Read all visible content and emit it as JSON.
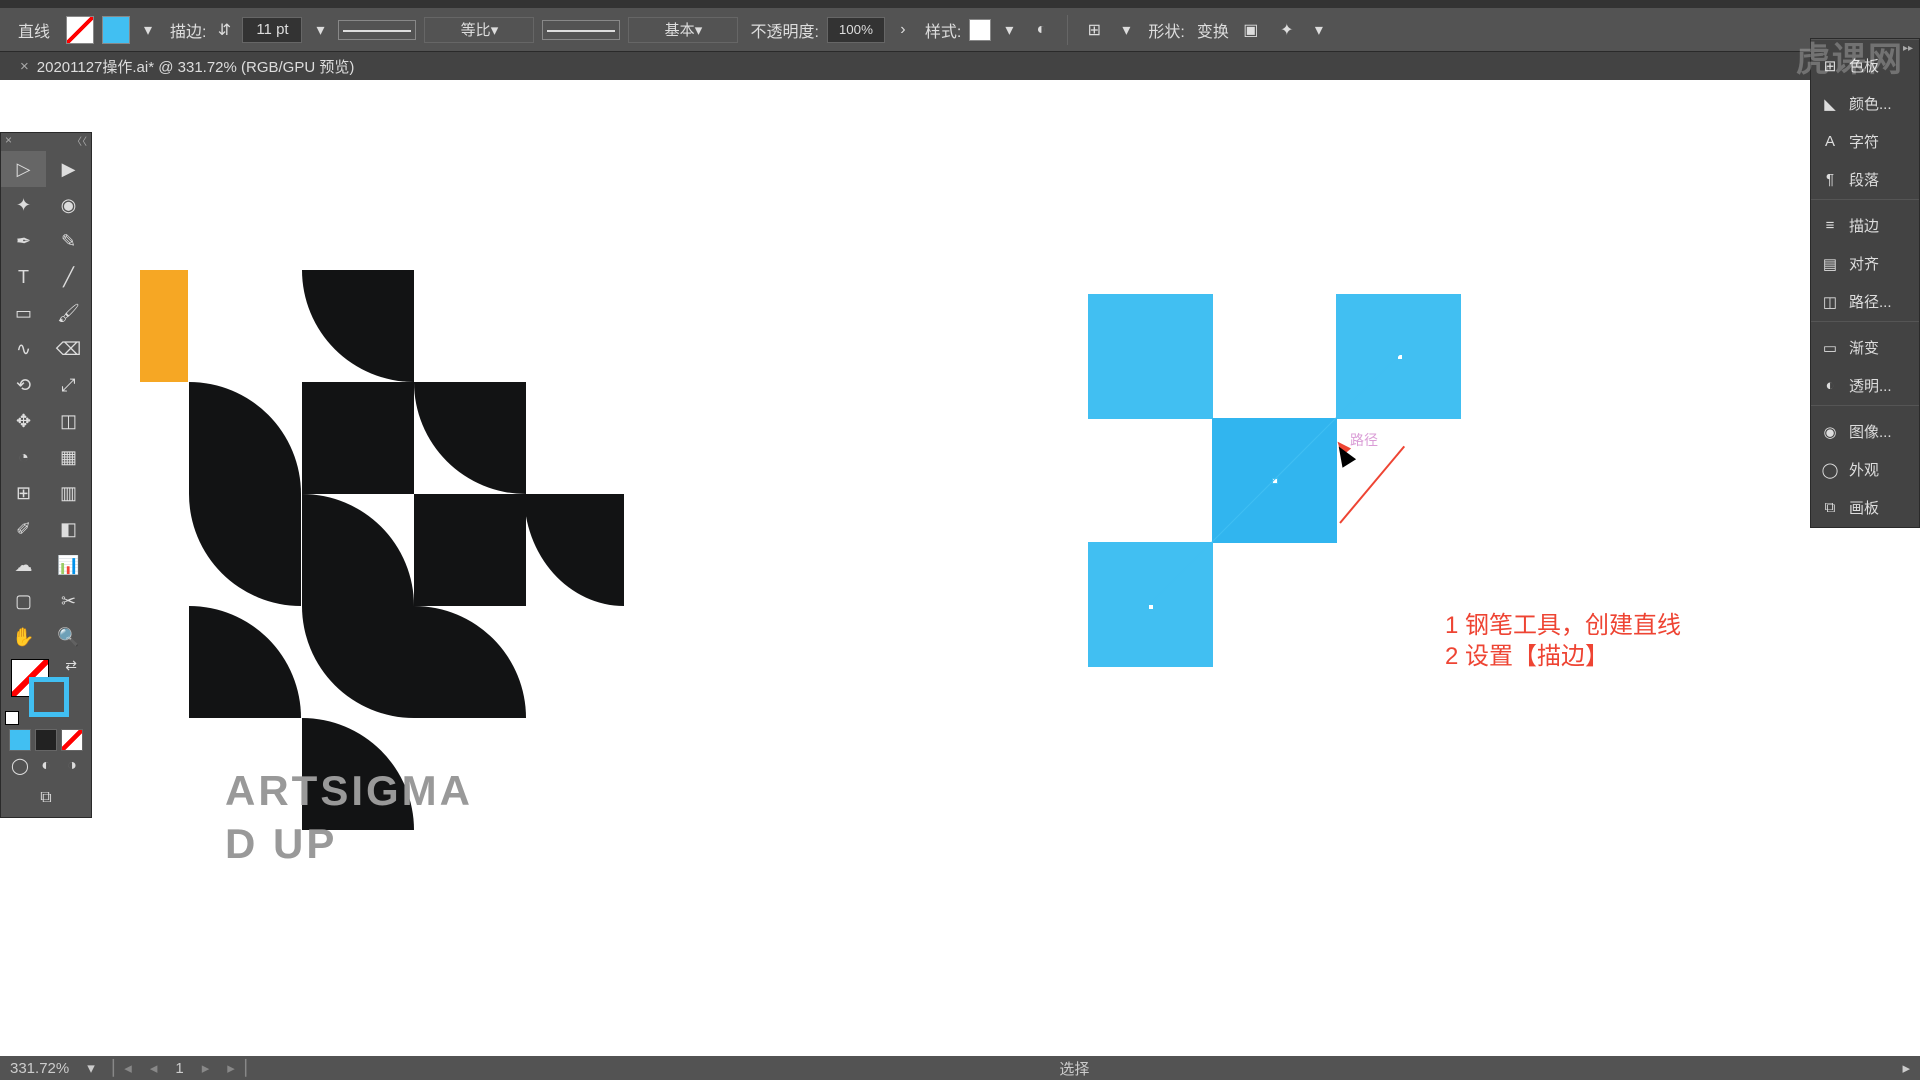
{
  "app": {
    "tool_name": "直线",
    "doc_tab": "20201127操作.ai* @ 331.72% (RGB/GPU 预览)"
  },
  "options": {
    "stroke_label": "描边:",
    "stroke_weight": "11 pt",
    "profile_label": "等比",
    "brush_label": "基本",
    "opacity_label": "不透明度:",
    "opacity_value": "100%",
    "style_label": "样式:",
    "shape_label": "形状:",
    "transform_label": "变换"
  },
  "panels": {
    "groups": [
      {
        "sep": true
      },
      {
        "icon": "swatches",
        "label": "色板"
      },
      {
        "icon": "color",
        "label": "颜色..."
      },
      {
        "icon": "char",
        "label": "字符"
      },
      {
        "icon": "para",
        "label": "段落"
      },
      {
        "sep": true
      },
      {
        "icon": "stroke",
        "label": "描边"
      },
      {
        "icon": "align",
        "label": "对齐"
      },
      {
        "icon": "path",
        "label": "路径..."
      },
      {
        "sep": true
      },
      {
        "icon": "grad",
        "label": "渐变"
      },
      {
        "icon": "trans",
        "label": "透明..."
      },
      {
        "sep": true
      },
      {
        "icon": "image",
        "label": "图像..."
      },
      {
        "icon": "appear",
        "label": "外观"
      },
      {
        "icon": "artb",
        "label": "画板"
      }
    ]
  },
  "canvas": {
    "text1": "ARTSIGMA",
    "text2": "D UP",
    "path_hint": "路径",
    "annotation_1": "1 钢笔工具，创建直线",
    "annotation_2": "2 设置【描边】"
  },
  "status": {
    "zoom": "331.72%",
    "page": "1",
    "tool_hint": "选择"
  },
  "watermark": "虎课网"
}
